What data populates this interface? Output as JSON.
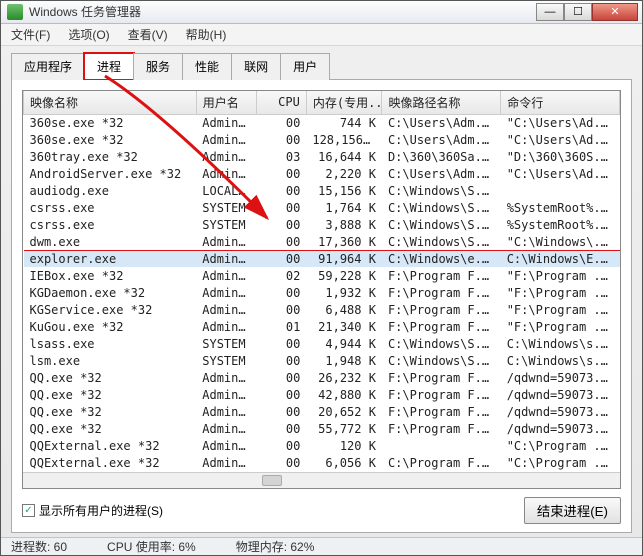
{
  "window": {
    "title": "Windows 任务管理器"
  },
  "menu": {
    "file": "文件(F)",
    "options": "选项(O)",
    "view": "查看(V)",
    "help": "帮助(H)"
  },
  "tabs": {
    "apps": "应用程序",
    "processes": "进程",
    "services": "服务",
    "performance": "性能",
    "networking": "联网",
    "users": "用户"
  },
  "columns": {
    "image": "映像名称",
    "user": "用户名",
    "cpu": "CPU",
    "mem": "内存(专用...",
    "path": "映像路径名称",
    "cmd": "命令行"
  },
  "processes": [
    {
      "image": "360se.exe *32",
      "user": "Admini...",
      "cpu": "00",
      "mem": "744 K",
      "path": "C:\\Users\\Adm...",
      "cmd": "\"C:\\Users\\Ad..."
    },
    {
      "image": "360se.exe *32",
      "user": "Admini...",
      "cpu": "00",
      "mem": "128,156 K",
      "path": "C:\\Users\\Adm...",
      "cmd": "\"C:\\Users\\Ad..."
    },
    {
      "image": "360tray.exe *32",
      "user": "Admini...",
      "cpu": "03",
      "mem": "16,644 K",
      "path": "D:\\360\\360Sa...",
      "cmd": "\"D:\\360\\360S..."
    },
    {
      "image": "AndroidServer.exe *32",
      "user": "Admini...",
      "cpu": "00",
      "mem": "2,220 K",
      "path": "C:\\Users\\Adm...",
      "cmd": "\"C:\\Users\\Ad..."
    },
    {
      "image": "audiodg.exe",
      "user": "LOCAL ...",
      "cpu": "00",
      "mem": "15,156 K",
      "path": "C:\\Windows\\S...",
      "cmd": ""
    },
    {
      "image": "csrss.exe",
      "user": "SYSTEM",
      "cpu": "00",
      "mem": "1,764 K",
      "path": "C:\\Windows\\S...",
      "cmd": "%SystemRoot%..."
    },
    {
      "image": "csrss.exe",
      "user": "SYSTEM",
      "cpu": "00",
      "mem": "3,888 K",
      "path": "C:\\Windows\\S...",
      "cmd": "%SystemRoot%..."
    },
    {
      "image": "dwm.exe",
      "user": "Admini...",
      "cpu": "00",
      "mem": "17,360 K",
      "path": "C:\\Windows\\S...",
      "cmd": "\"C:\\Windows\\..."
    },
    {
      "image": "explorer.exe",
      "user": "Admini...",
      "cpu": "00",
      "mem": "91,964 K",
      "path": "C:\\Windows\\e...",
      "cmd": "C:\\Windows\\E..."
    },
    {
      "image": "IEBox.exe *32",
      "user": "Admini...",
      "cpu": "02",
      "mem": "59,228 K",
      "path": "F:\\Program F...",
      "cmd": "\"F:\\Program ..."
    },
    {
      "image": "KGDaemon.exe *32",
      "user": "Admini...",
      "cpu": "00",
      "mem": "1,932 K",
      "path": "F:\\Program F...",
      "cmd": "\"F:\\Program ..."
    },
    {
      "image": "KGService.exe *32",
      "user": "Admini...",
      "cpu": "00",
      "mem": "6,488 K",
      "path": "F:\\Program F...",
      "cmd": "\"F:\\Program ..."
    },
    {
      "image": "KuGou.exe *32",
      "user": "Admini...",
      "cpu": "01",
      "mem": "21,340 K",
      "path": "F:\\Program F...",
      "cmd": "\"F:\\Program ..."
    },
    {
      "image": "lsass.exe",
      "user": "SYSTEM",
      "cpu": "00",
      "mem": "4,944 K",
      "path": "C:\\Windows\\S...",
      "cmd": "C:\\Windows\\s..."
    },
    {
      "image": "lsm.exe",
      "user": "SYSTEM",
      "cpu": "00",
      "mem": "1,948 K",
      "path": "C:\\Windows\\S...",
      "cmd": "C:\\Windows\\s..."
    },
    {
      "image": "QQ.exe *32",
      "user": "Admini...",
      "cpu": "00",
      "mem": "26,232 K",
      "path": "F:\\Program F...",
      "cmd": "/qdwnd=59073..."
    },
    {
      "image": "QQ.exe *32",
      "user": "Admini...",
      "cpu": "00",
      "mem": "42,880 K",
      "path": "F:\\Program F...",
      "cmd": "/qdwnd=59073..."
    },
    {
      "image": "QQ.exe *32",
      "user": "Admini...",
      "cpu": "00",
      "mem": "20,652 K",
      "path": "F:\\Program F...",
      "cmd": "/qdwnd=59073..."
    },
    {
      "image": "QQ.exe *32",
      "user": "Admini...",
      "cpu": "00",
      "mem": "55,772 K",
      "path": "F:\\Program F...",
      "cmd": "/qdwnd=59073..."
    },
    {
      "image": "QQExternal.exe *32",
      "user": "Admini...",
      "cpu": "00",
      "mem": "120 K",
      "path": "",
      "cmd": "\"C:\\Program ..."
    },
    {
      "image": "QQExternal.exe *32",
      "user": "Admini...",
      "cpu": "00",
      "mem": "6,056 K",
      "path": "C:\\Program F...",
      "cmd": "\"C:\\Program ..."
    }
  ],
  "selected_index": 8,
  "highlighted_index": 8,
  "checkbox": {
    "label": "显示所有用户的进程(S)",
    "checked": true
  },
  "end_process_btn": "结束进程(E)",
  "status": {
    "processes": "进程数: 60",
    "cpu": "CPU 使用率: 6%",
    "mem": "物理内存: 62%"
  },
  "colors": {
    "highlight": "#d11",
    "selected_bg": "#d6e8f7"
  }
}
